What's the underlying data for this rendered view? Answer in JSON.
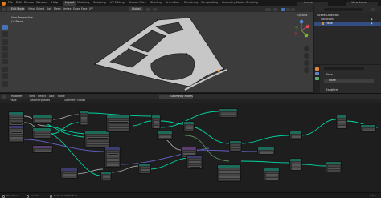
{
  "topbar": {
    "menus": [
      "File",
      "Edit",
      "Render",
      "Window",
      "Help"
    ],
    "workspaces": [
      "Layout",
      "Modeling",
      "Sculpting",
      "UV Editing",
      "Texture Paint",
      "Shading",
      "Animation",
      "Rendering",
      "Compositing",
      "Geometry Nodes",
      "Scripting"
    ],
    "active_workspace": "Layout",
    "scene_label": "Scene",
    "view_layer_label": "View Layer"
  },
  "viewport": {
    "mode_label": "Edit Mode",
    "menus": [
      "View",
      "Select",
      "Add",
      "Mesh",
      "Vertex",
      "Edge",
      "Face",
      "UV"
    ],
    "transform_label": "Global",
    "overlay_title": "User Perspective",
    "overlay_object": "(1) Plane",
    "options_label": "Options",
    "gizmo_axes": [
      "X",
      "Y",
      "Z"
    ]
  },
  "outliner": {
    "items": [
      "Scene Collection",
      "Collection",
      "Plane"
    ]
  },
  "properties": {
    "object_name": "Plane",
    "mesh_name": "Plane",
    "section": "Transform"
  },
  "node_editor": {
    "editor_label": "Modifier",
    "menus": [
      "View",
      "Select",
      "Add",
      "Node"
    ],
    "tree_name": "Geometry Nodes",
    "breadcrumb": [
      "Plane",
      "GeometryNodes",
      "Geometry Nodes"
    ]
  },
  "statusbar": {
    "hints": [
      "Pan View",
      "Select",
      "Node Context Menu"
    ],
    "version": "3.6.2"
  },
  "colors": {
    "accent": "#4772b3",
    "geometry_socket": "#00d6a3",
    "vector_socket": "#6363c7",
    "float_socket": "#a1a1a1",
    "int_socket": "#598c5c",
    "node_header": "#1e6a58"
  }
}
